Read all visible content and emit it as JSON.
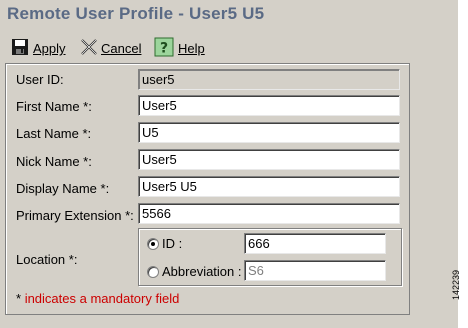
{
  "page": {
    "title": "Remote User Profile - User5 U5",
    "figure_id": "142239"
  },
  "toolbar": {
    "apply_label": "Apply",
    "apply_icon": "floppy-disk-icon",
    "cancel_label": "Cancel",
    "cancel_icon": "close-x-icon",
    "help_label": "Help",
    "help_icon": "question-mark-icon"
  },
  "form": {
    "user_id": {
      "label": "User ID:",
      "value": "user5"
    },
    "first_name": {
      "label": "First Name *:",
      "value": "User5"
    },
    "last_name": {
      "label": "Last Name *:",
      "value": "U5"
    },
    "nick_name": {
      "label": "Nick Name *:",
      "value": "User5"
    },
    "display_name": {
      "label": "Display Name *:",
      "value": "User5 U5"
    },
    "primary_extension": {
      "label": "Primary Extension *:",
      "value": "5566"
    },
    "location": {
      "label": "Location *:",
      "id_option": {
        "label": "ID :",
        "value": "666",
        "selected": true
      },
      "abbreviation_option": {
        "label": "Abbreviation :",
        "value": "S6",
        "selected": false
      }
    }
  },
  "note": {
    "star": "*",
    "text": "indicates a mandatory field"
  },
  "colors": {
    "background": "#d4d0c8",
    "title": "#5a6a85",
    "mandatory_note": "#cc0000"
  }
}
